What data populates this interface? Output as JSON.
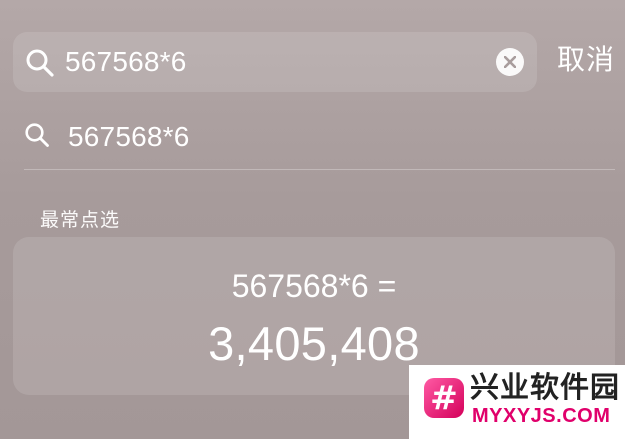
{
  "search": {
    "value": "567568*6",
    "icon": "search-icon",
    "clear_icon": "clear-icon"
  },
  "cancel_label": "取消",
  "suggestion": {
    "icon": "search-icon",
    "label": "567568*6"
  },
  "section_title": "最常点选",
  "result": {
    "expression": "567568*6 =",
    "answer": "3,405,408"
  },
  "watermark": {
    "badge_symbol": "#",
    "name": "兴业软件园",
    "url": "MYXYJS.COM"
  },
  "colors": {
    "background": "#aa9e9e",
    "text": "#ffffff",
    "watermark_pink": "#e0006b"
  }
}
